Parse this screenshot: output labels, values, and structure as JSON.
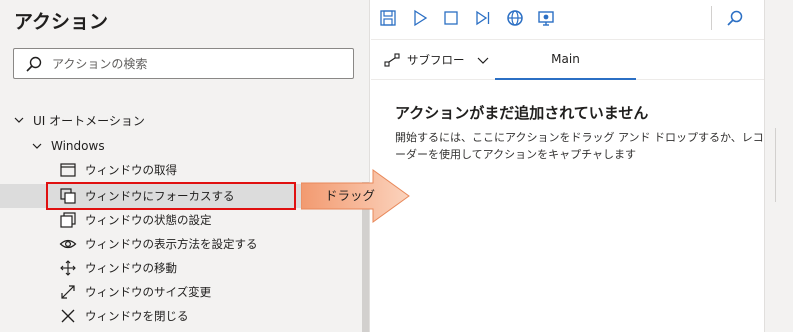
{
  "actions_pane": {
    "title": "アクション",
    "search": {
      "placeholder": "アクションの検索",
      "value": ""
    },
    "tree": {
      "group": {
        "label": "UI オートメーション",
        "expanded": true
      },
      "subgroup": {
        "label": "Windows",
        "expanded": true
      },
      "items": [
        {
          "label": "ウィンドウの取得",
          "icon": "window-icon",
          "selected": false
        },
        {
          "label": "ウィンドウにフォーカスする",
          "icon": "focus-window-icon",
          "selected": true
        },
        {
          "label": "ウィンドウの状態の設定",
          "icon": "window-state-icon",
          "selected": false
        },
        {
          "label": "ウィンドウの表示方法を設定する",
          "icon": "eye-icon",
          "selected": false
        },
        {
          "label": "ウィンドウの移動",
          "icon": "move-icon",
          "selected": false
        },
        {
          "label": "ウィンドウのサイズ変更",
          "icon": "resize-icon",
          "selected": false
        },
        {
          "label": "ウィンドウを閉じる",
          "icon": "close-icon",
          "selected": false
        }
      ]
    }
  },
  "toolbar": {
    "buttons": [
      {
        "name": "save-icon",
        "color": "#2b6fc4"
      },
      {
        "name": "run-icon",
        "color": "#2b6fc4"
      },
      {
        "name": "stop-icon",
        "color": "#2b6fc4"
      },
      {
        "name": "next-step-icon",
        "color": "#2b6fc4"
      },
      {
        "name": "web-recorder-icon",
        "color": "#2b6fc4"
      },
      {
        "name": "desktop-recorder-icon",
        "color": "#2b6fc4"
      },
      {
        "name": "search-icon",
        "color": "#2b6fc4"
      }
    ]
  },
  "tabs": {
    "subflow_label": "サブフロー",
    "main_label": "Main"
  },
  "designer": {
    "empty_title": "アクションがまだ追加されていません",
    "empty_description": "開始するには、ここにアクションをドラッグ アンド ドロップするか、レコーダーを使用してアクションをキャプチャします"
  },
  "annotation": {
    "drag_label": "ドラッグ",
    "arrow_color": "#f4a47c",
    "highlight_color": "#e01010"
  }
}
